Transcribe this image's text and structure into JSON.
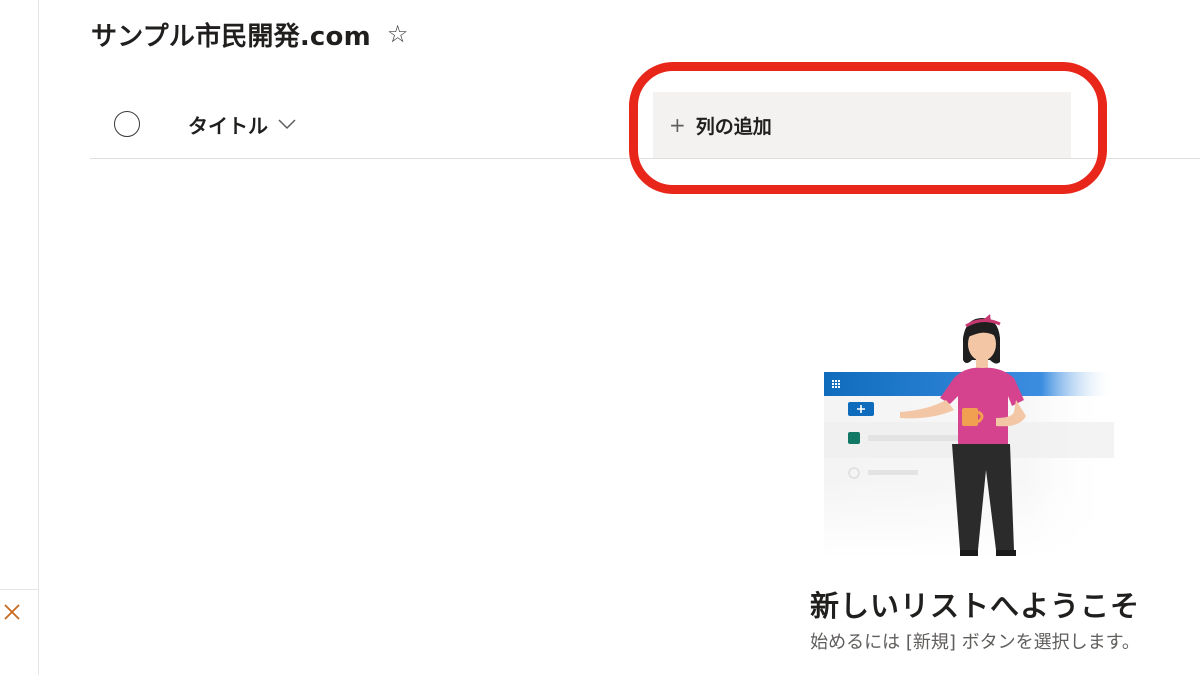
{
  "site": {
    "title": "サンプル市民開発.com",
    "star_icon": "☆"
  },
  "list_header": {
    "title_column": "タイトル",
    "add_column_plus": "+",
    "add_column_label": "列の追加"
  },
  "empty_state": {
    "heading": "新しいリストへようこそ",
    "message": "始めるには [新規] ボタンを選択します。"
  },
  "colors": {
    "highlight": "#e8261a",
    "add_column_bg": "#f3f2f1",
    "brand_blue": "#0f6cbd",
    "close_icon": "#c8691c"
  },
  "icons": {
    "close": "close-icon",
    "star": "star-icon",
    "chevron": "chevron-down-icon",
    "select": "select-all-circle"
  }
}
